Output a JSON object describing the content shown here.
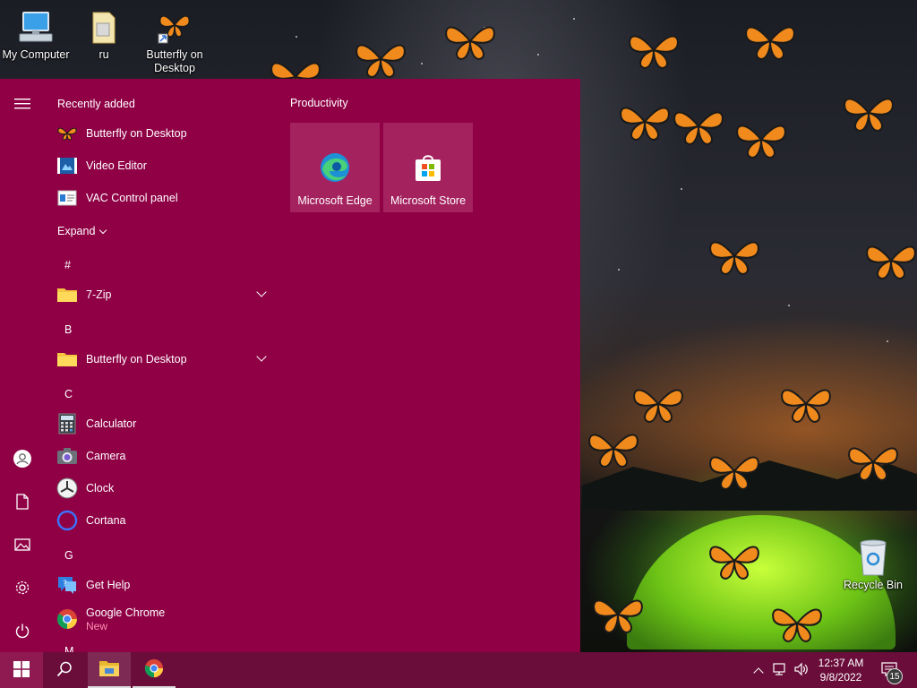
{
  "desktop": {
    "icons": [
      {
        "label": "My Computer",
        "icon": "computer-icon"
      },
      {
        "label": "ru",
        "icon": "folder-icon"
      },
      {
        "label": "Butterfly on Desktop",
        "icon": "butterfly-shortcut-icon"
      },
      {
        "label": "Recycle Bin",
        "icon": "recycle-bin-icon"
      }
    ]
  },
  "start_menu": {
    "recently_added_title": "Recently added",
    "recent": [
      {
        "label": "Butterfly on Desktop",
        "icon": "butterfly-icon"
      },
      {
        "label": "Video Editor",
        "icon": "video-editor-icon"
      },
      {
        "label": "VAC Control panel",
        "icon": "vac-panel-icon"
      }
    ],
    "expand_label": "Expand",
    "sections": [
      {
        "letter": "#",
        "apps": [
          {
            "label": "7-Zip",
            "icon": "folder-icon",
            "expandable": true
          }
        ]
      },
      {
        "letter": "B",
        "apps": [
          {
            "label": "Butterfly on Desktop",
            "icon": "folder-icon",
            "expandable": true
          }
        ]
      },
      {
        "letter": "C",
        "apps": [
          {
            "label": "Calculator",
            "icon": "calculator-icon"
          },
          {
            "label": "Camera",
            "icon": "camera-icon"
          },
          {
            "label": "Clock",
            "icon": "clock-icon"
          },
          {
            "label": "Cortana",
            "icon": "cortana-icon"
          }
        ]
      },
      {
        "letter": "G",
        "apps": [
          {
            "label": "Get Help",
            "icon": "get-help-icon"
          },
          {
            "label": "Google Chrome",
            "sublabel": "New",
            "icon": "chrome-icon"
          }
        ]
      },
      {
        "letter": "M",
        "apps": []
      }
    ],
    "rail": [
      "hamburger-menu-icon",
      "user-icon",
      "documents-icon",
      "pictures-icon",
      "settings-icon",
      "power-icon"
    ],
    "tile_group": {
      "title": "Productivity",
      "tiles": [
        {
          "label": "Microsoft Edge",
          "icon": "edge-icon"
        },
        {
          "label": "Microsoft Store",
          "icon": "store-icon"
        }
      ]
    }
  },
  "taskbar": {
    "pinned": [
      "start-icon",
      "search-icon",
      "file-explorer-icon",
      "chrome-icon"
    ],
    "clock": {
      "time": "12:37 AM",
      "date": "9/8/2022"
    },
    "notifications_count": "15"
  },
  "colors": {
    "start_bg": "#8f0045",
    "tile_bg": "#a4225e",
    "taskbar_bg": "#6a0d3a",
    "new_label": "#ff8fb3"
  }
}
